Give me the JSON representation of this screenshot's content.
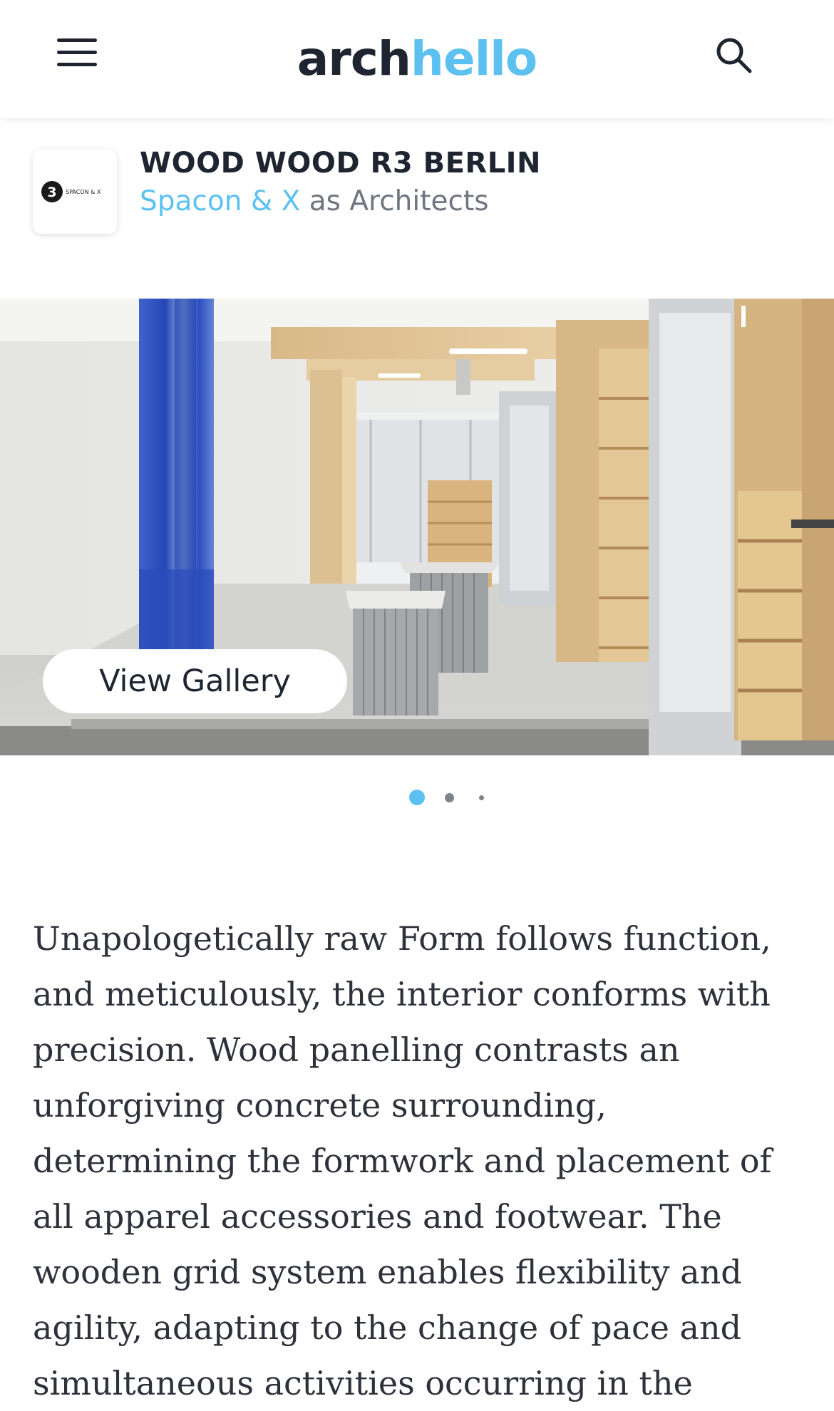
{
  "header": {
    "logo_part1": "arch",
    "logo_part2": "ello",
    "logo_h": "h"
  },
  "project": {
    "title": "WOOD WOOD R3 BERLIN",
    "firm_name": "Spacon & X",
    "role_text": " as Architects",
    "firm_logo_text": "SPACON & X"
  },
  "gallery": {
    "button_label": "View Gallery",
    "slide_count": 3,
    "active_slide": 1
  },
  "description": "Unapologetically raw Form follows function, and meticulously, the interior conforms with precision. Wood panelling contrasts an unforgiving concrete surrounding, determining the formwork and placement of all apparel accessories and footwear. The wooden grid system enables flexibility and agility, adapting to the change of pace and simultaneous activities occurring in the",
  "colors": {
    "accent": "#5cc1f0",
    "text_dark": "#1e2530",
    "text_muted": "#6f7680"
  }
}
